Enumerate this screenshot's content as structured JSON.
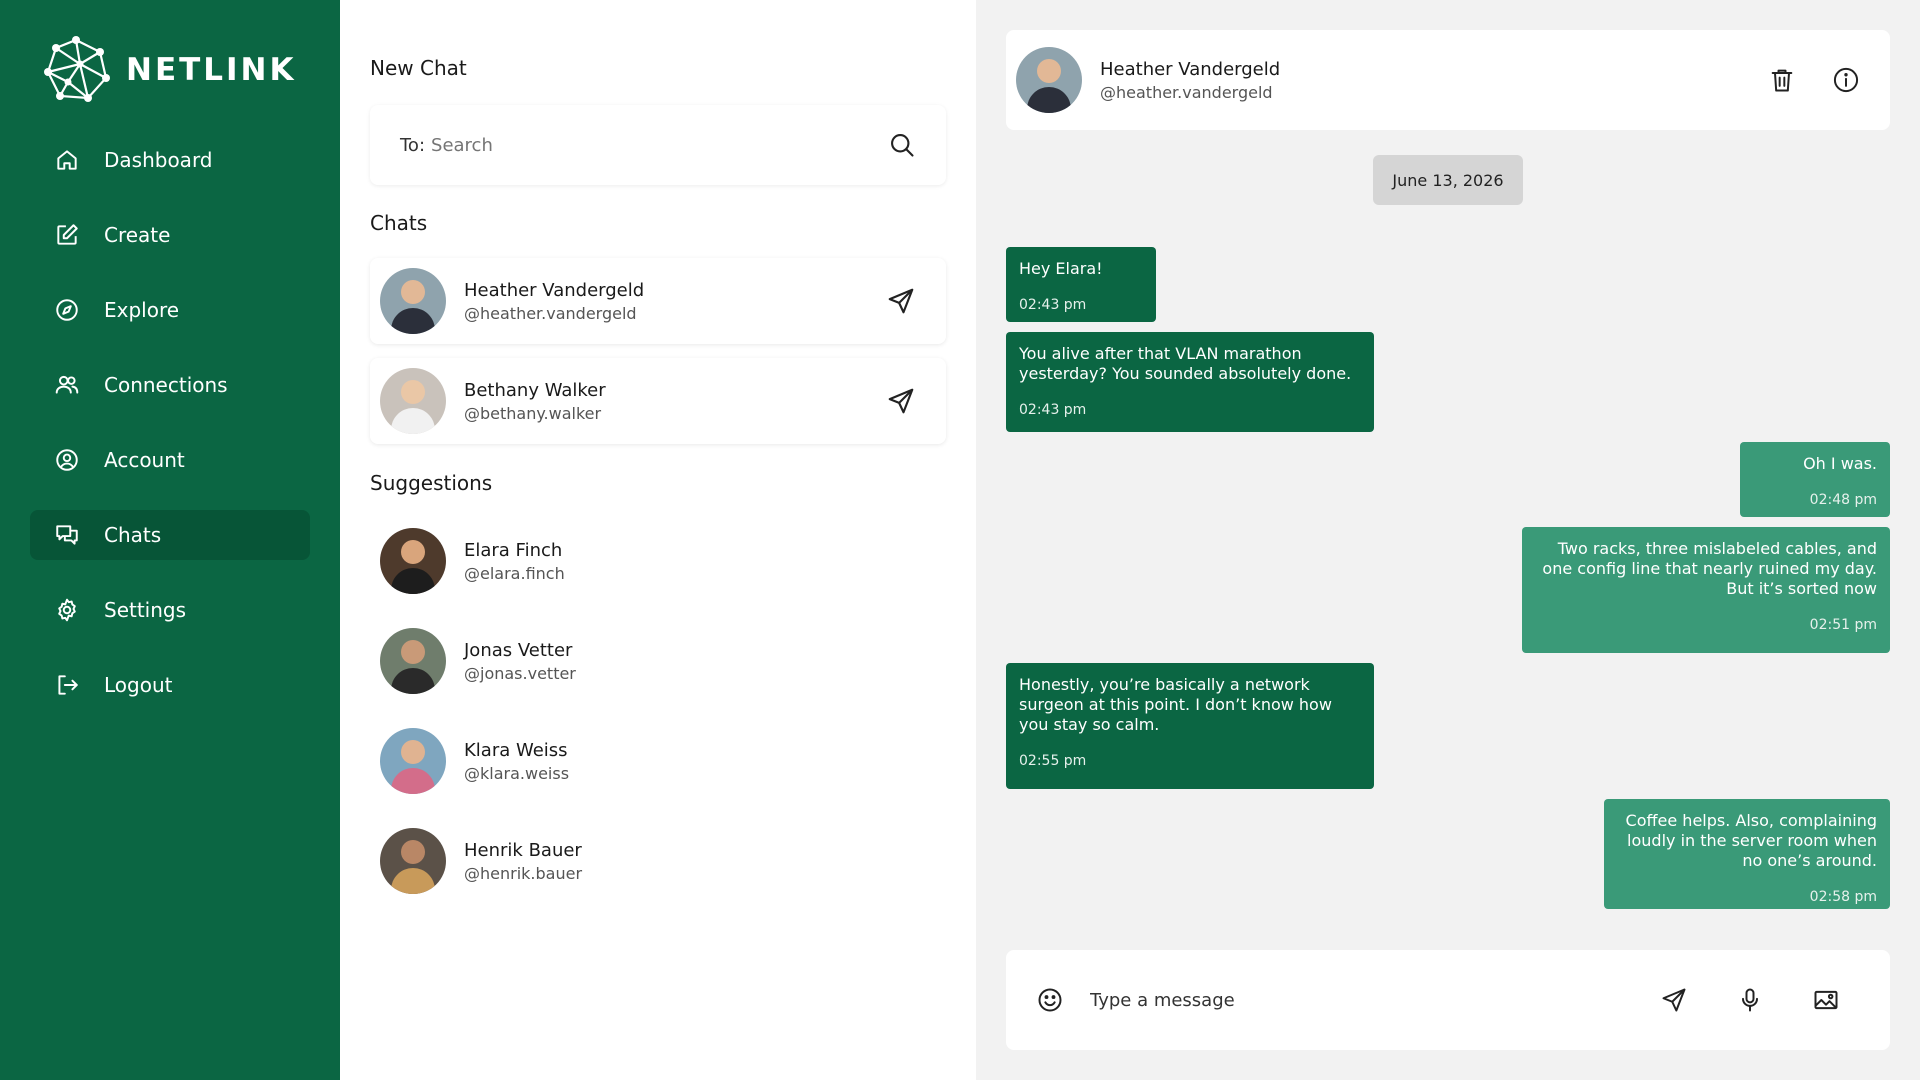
{
  "brand": {
    "name": "NETLINK"
  },
  "colors": {
    "sidebar": "#0b6643",
    "sidebar_active": "#075537",
    "incoming": "#0b6643",
    "outgoing": "#3a9a78",
    "panel_bg": "#f2f2f2"
  },
  "sidebar": {
    "items": [
      {
        "label": "Dashboard",
        "icon": "home-icon"
      },
      {
        "label": "Create",
        "icon": "edit-icon"
      },
      {
        "label": "Explore",
        "icon": "compass-icon"
      },
      {
        "label": "Connections",
        "icon": "users-icon"
      },
      {
        "label": "Account",
        "icon": "user-circle-icon"
      },
      {
        "label": "Chats",
        "icon": "chat-icon",
        "active": true
      },
      {
        "label": "Settings",
        "icon": "gear-icon"
      },
      {
        "label": "Logout",
        "icon": "logout-icon"
      }
    ]
  },
  "new_chat": {
    "title": "New Chat",
    "to_label": "To:",
    "search_placeholder": "Search"
  },
  "chats": {
    "title": "Chats",
    "items": [
      {
        "name": "Heather Vandergeld",
        "handle": "@heather.vandergeld"
      },
      {
        "name": "Bethany Walker",
        "handle": "@bethany.walker"
      }
    ]
  },
  "suggestions": {
    "title": "Suggestions",
    "items": [
      {
        "name": "Elara Finch",
        "handle": "@elara.finch"
      },
      {
        "name": "Jonas Vetter",
        "handle": "@jonas.vetter"
      },
      {
        "name": "Klara Weiss",
        "handle": "@klara.weiss"
      },
      {
        "name": "Henrik Bauer",
        "handle": "@henrik.bauer"
      }
    ]
  },
  "conversation": {
    "contact_name": "Heather Vandergeld",
    "contact_handle": "@heather.vandergeld",
    "date": "June 13, 2026",
    "messages": [
      {
        "direction": "in",
        "text": "Hey Elara!",
        "time": "02:43 pm"
      },
      {
        "direction": "in",
        "text": "You alive after that VLAN marathon\nyesterday? You sounded absolutely done.",
        "time": "02:43 pm"
      },
      {
        "direction": "out",
        "text": "Oh I was.",
        "time": "02:48 pm"
      },
      {
        "direction": "out",
        "text": "Two racks, three mislabeled cables, and\none config line that nearly ruined my day.\nBut it’s sorted now",
        "time": "02:51 pm"
      },
      {
        "direction": "in",
        "text": "Honestly, you’re basically a network\nsurgeon at this point. I don’t know how\nyou stay so calm.",
        "time": "02:55 pm"
      },
      {
        "direction": "out",
        "text": "Coffee helps. Also, complaining\nloudly in the server room when\nno one’s around.",
        "time": "02:58 pm"
      }
    ]
  },
  "composer": {
    "placeholder": "Type a message"
  }
}
